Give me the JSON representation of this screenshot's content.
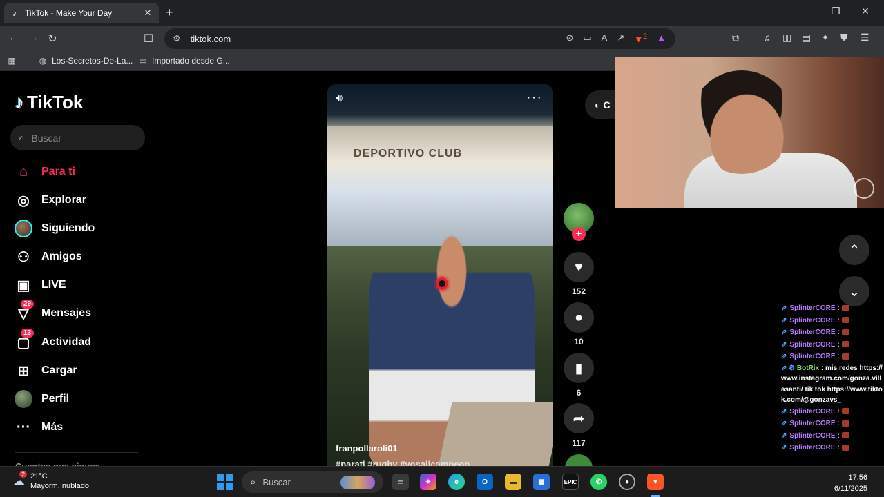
{
  "browser": {
    "tab_title": "TikTok - Make Your Day",
    "url": "tiktok.com",
    "shields_count": "2",
    "bookmarks": [
      {
        "label": "Los-Secretos-De-La...",
        "icon": "globe-icon"
      },
      {
        "label": "Importado desde G...",
        "icon": "folder-icon"
      }
    ]
  },
  "tiktok": {
    "logo": "TikTok",
    "search_placeholder": "Buscar",
    "nav": [
      {
        "label": "Para ti",
        "icon": "home-icon",
        "active": true
      },
      {
        "label": "Explorar",
        "icon": "compass-icon"
      },
      {
        "label": "Siguiendo",
        "icon": "following-avatar"
      },
      {
        "label": "Amigos",
        "icon": "friends-icon"
      },
      {
        "label": "LIVE",
        "icon": "live-icon"
      },
      {
        "label": "Mensajes",
        "icon": "messages-icon",
        "badge": "29"
      },
      {
        "label": "Actividad",
        "icon": "activity-icon",
        "badge": "13"
      },
      {
        "label": "Cargar",
        "icon": "upload-icon"
      },
      {
        "label": "Perfil",
        "icon": "profile-avatar"
      },
      {
        "label": "Más",
        "icon": "more-icon"
      }
    ],
    "following_header": "Cuentas que sigues",
    "video": {
      "username": "franpollaroli01",
      "hashtags": "#parati #rugby #yosalicampeon",
      "sign_text": "DEPORTIVO CLUB"
    },
    "actions": {
      "likes": "152",
      "comments": "10",
      "saves": "6",
      "shares": "117"
    },
    "coins_label": "C"
  },
  "chat": {
    "lines_top": [
      {
        "user": "SplinterCORE",
        "msg": ":"
      },
      {
        "user": "SplinterCORE",
        "msg": ":"
      },
      {
        "user": "SplinterCORE",
        "msg": ":"
      },
      {
        "user": "SplinterCORE",
        "msg": ":"
      },
      {
        "user": "SplinterCORE",
        "msg": ":"
      }
    ],
    "bot_user": "BotRix",
    "bot_msg": ": mis redes https://www.instagram.com/gonza.villasanti/ tik tok https://www.tiktok.com/@gonzavs_",
    "lines_bottom": [
      {
        "user": "SplinterCORE",
        "msg": ":"
      },
      {
        "user": "SplinterCORE",
        "msg": ":"
      },
      {
        "user": "SplinterCORE",
        "msg": ":"
      },
      {
        "user": "SplinterCORE",
        "msg": ":"
      }
    ]
  },
  "taskbar": {
    "weather_temp": "21°C",
    "weather_desc": "Mayorm. nublado",
    "weather_badge": "2",
    "search_placeholder": "Buscar",
    "time": "17:56",
    "date": "6/11/2025"
  },
  "colors": {
    "tiktok_red": "#fe2c55",
    "tiktok_cyan": "#25f4ee",
    "chat_user": "#b57cff",
    "chat_bot": "#7be15b"
  }
}
